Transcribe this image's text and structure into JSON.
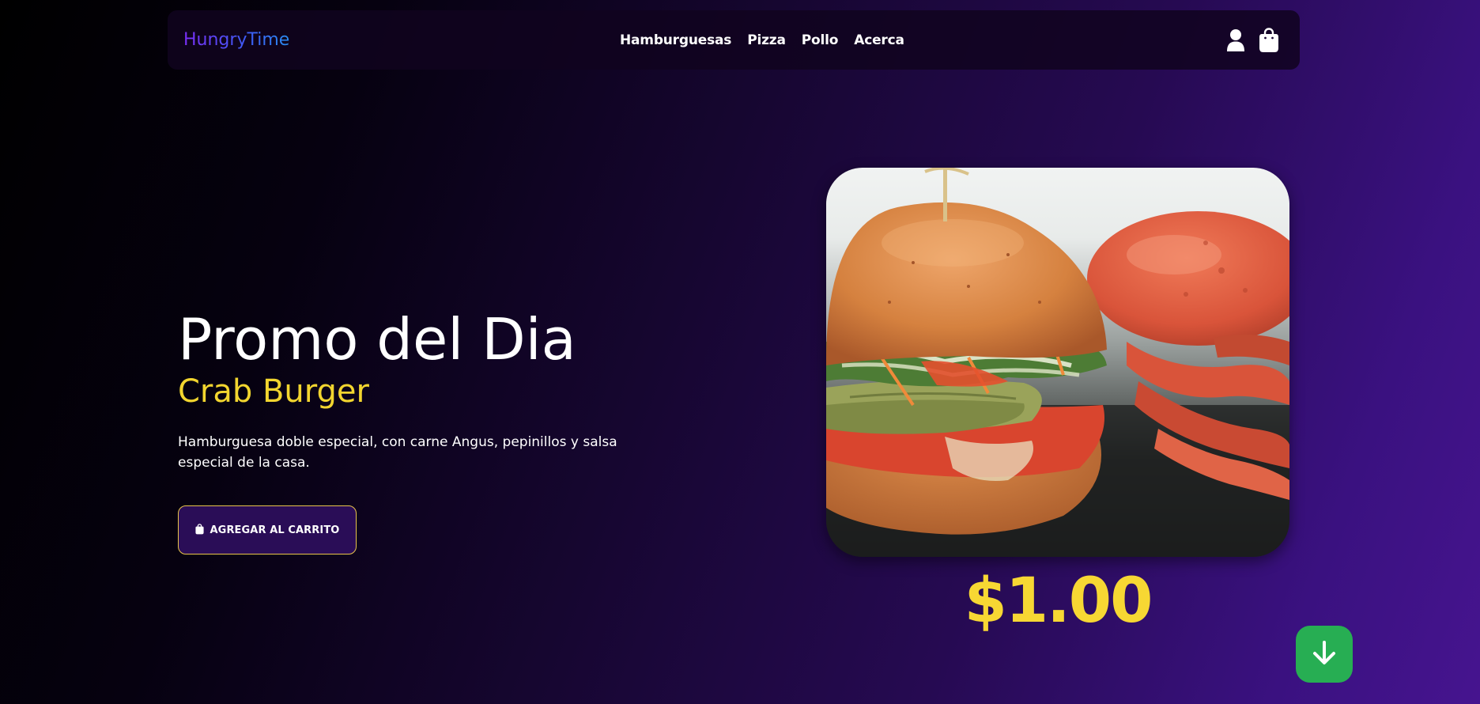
{
  "header": {
    "brand": "HungryTime",
    "nav_links": [
      "Hamburguesas",
      "Pizza",
      "Pollo",
      "Acerca"
    ],
    "icons": [
      "user-icon",
      "shopping-bag-icon"
    ]
  },
  "hero": {
    "title": "Promo del Dia",
    "subtitle": "Crab Burger",
    "description": "Hamburguesa doble especial, con carne Angus, pepinillos y salsa especial de la casa.",
    "cart_button_label": "AGREGAR AL CARRITO",
    "cart_button_icon": "shopping-bag-icon"
  },
  "product": {
    "price": "$1.00"
  },
  "scroll_button": {
    "icon": "arrow-down-icon"
  },
  "colors": {
    "accent_yellow": "#f2d52f",
    "scroll_button_green": "#27ae53",
    "brand_gradient_start": "#7b2ff7",
    "brand_gradient_end": "#2a8cf0"
  }
}
